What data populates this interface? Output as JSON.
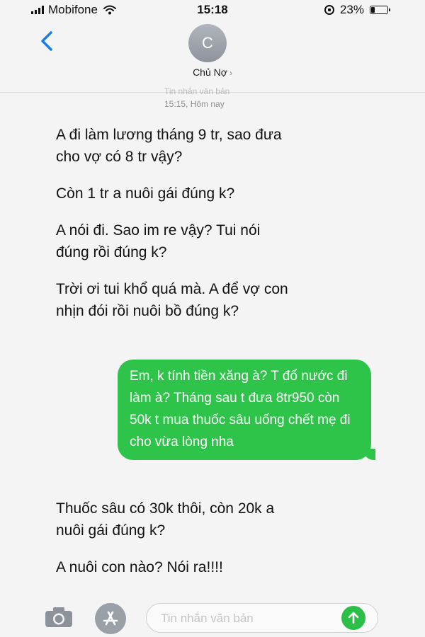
{
  "status_bar": {
    "carrier": "Mobifone",
    "time": "15:18",
    "battery_percent": "23%",
    "battery_level": 0.23,
    "icons": [
      "signal-icon",
      "wifi-icon",
      "orientation-lock-icon",
      "battery-icon"
    ]
  },
  "header": {
    "back_icon": "chevron-left-icon",
    "avatar_initial": "C",
    "contact_name": "Chủ Nợ",
    "contact_chevron": "›"
  },
  "meta": {
    "message_type": "Tin nhắn văn bản",
    "timestamp": "15:15, Hôm nay"
  },
  "messages": [
    {
      "direction": "incoming",
      "text": "A đi làm lương tháng 9 tr, sao đưa cho vợ có 8 tr vậy?"
    },
    {
      "direction": "incoming",
      "text": "Còn 1 tr a nuôi gái đúng k?"
    },
    {
      "direction": "incoming",
      "text": "A nói đi. Sao im re vậy? Tui nói đúng rồi đúng k?"
    },
    {
      "direction": "incoming",
      "text": "Trời ơi tui khổ quá mà. A để vợ con nhịn đói rồi nuôi bồ đúng k?"
    },
    {
      "direction": "outgoing",
      "text": "Em, k tính tiền xăng à? T đổ nước đi làm à? Tháng sau t đưa 8tr950 còn 50k t mua thuốc sâu uống chết mẹ đi cho vừa lòng nha"
    },
    {
      "direction": "incoming",
      "text": "Thuốc sâu có 30k thôi, còn 20k a nuôi gái đúng k?"
    },
    {
      "direction": "incoming",
      "text": "A nuôi con nào? Nói ra!!!!"
    }
  ],
  "input_bar": {
    "camera_icon": "camera-icon",
    "apps_icon": "app-store-icon",
    "placeholder": "Tin nhắn văn bản",
    "send_icon": "send-arrow-icon"
  },
  "colors": {
    "outgoing_bubble": "#2ec449",
    "send_button": "#2bbf48",
    "back_chevron": "#1a7ce5"
  }
}
